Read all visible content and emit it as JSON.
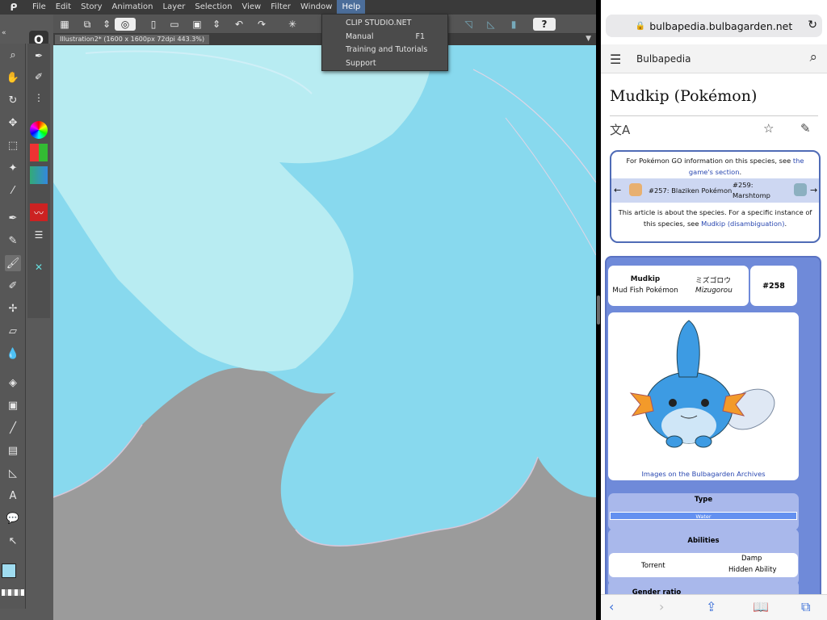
{
  "csp": {
    "menu": [
      "File",
      "Edit",
      "Story",
      "Animation",
      "Layer",
      "Selection",
      "View",
      "Filter",
      "Window",
      "Help"
    ],
    "active_menu": "Help",
    "help_menu": [
      {
        "label": "CLIP STUDIO.NET",
        "key": ""
      },
      {
        "label": "Manual",
        "key": "F1"
      },
      {
        "label": "Training and Tutorials",
        "key": ""
      },
      {
        "label": "Support",
        "key": ""
      }
    ],
    "document_tab": "Illustration2* (1600 x 1600px 72dpi 443.3%)",
    "colors": {
      "main": "#9fdcf0",
      "sub": "#ffffff",
      "canvas_light": "#b8ecf2",
      "canvas_mid": "#88d9ee",
      "canvas_gray": "#9b9b9b"
    }
  },
  "browser": {
    "url": "bulbapedia.bulbagarden.net",
    "site_name": "Bulbapedia",
    "page_title": "Mudkip (Pokémon)",
    "notice": {
      "go_text": "For Pokémon GO information on this species, see ",
      "go_link": "the game's section",
      "go_end": ".",
      "prev_label": "#257: Blaziken Pokémon",
      "next_label_1": "#259:",
      "next_label_2": "Marshtomp",
      "about_text": "This article is about the species. For a specific instance of this species, see ",
      "about_link": "Mudkip (disambiguation)",
      "about_end": "."
    },
    "infobox": {
      "name": "Mudkip",
      "category": "Mud Fish Pokémon",
      "jp_name": "ミズゴロウ",
      "romaji": "Mizugorou",
      "number": "#258",
      "images_link": "Images on the Bulbagarden Archives",
      "type_header": "Type",
      "type_value": "Water",
      "abilities_header": "Abilities",
      "ability_1": "Torrent",
      "ability_2": "Damp",
      "ability_2_note": "Hidden Ability",
      "gender_header": "Gender ratio"
    },
    "colors": {
      "infobox": "#6f8ad9",
      "water": "#6390f0",
      "link": "#2947b0"
    }
  }
}
